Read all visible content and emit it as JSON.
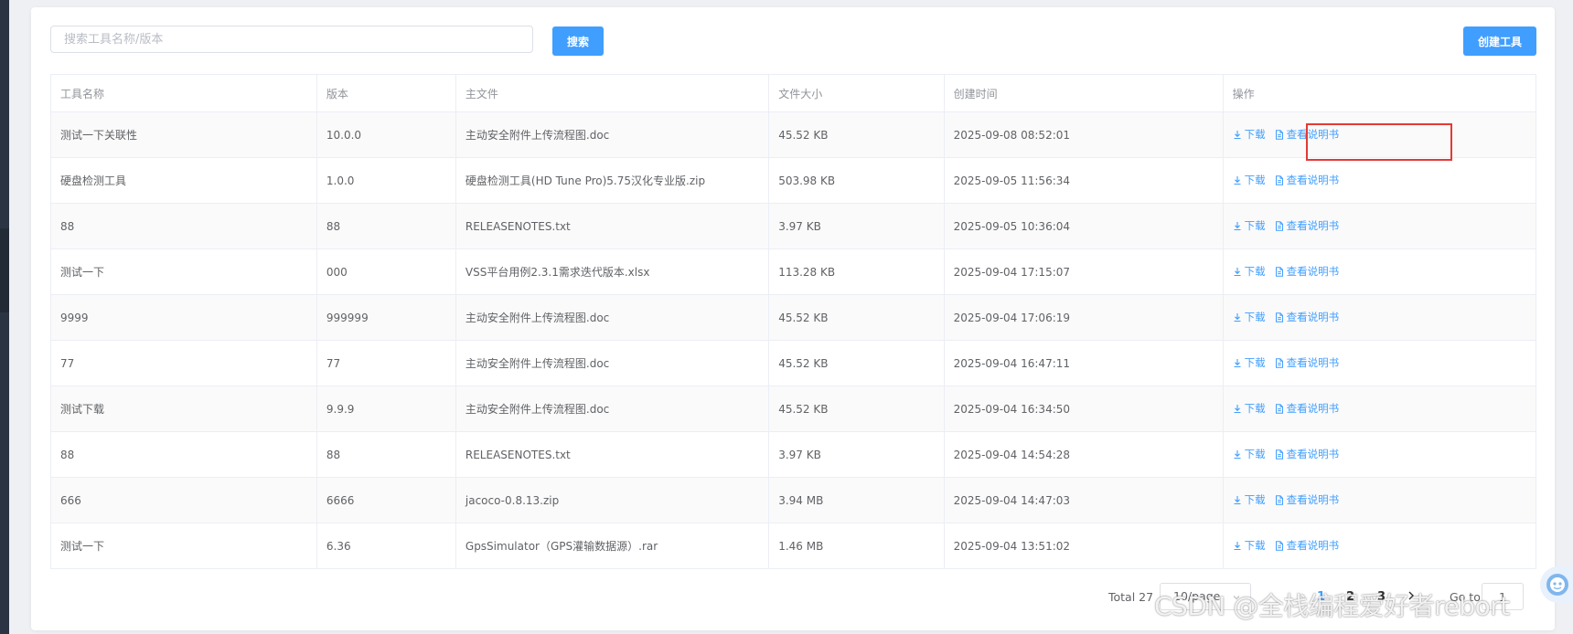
{
  "search": {
    "placeholder": "搜索工具名称/版本",
    "button_label": "搜索"
  },
  "toolbar": {
    "create_label": "创建工具"
  },
  "table": {
    "columns": [
      "工具名称",
      "版本",
      "主文件",
      "文件大小",
      "创建时间",
      "操作"
    ],
    "rows": [
      {
        "name": "测试一下关联性",
        "version": "10.0.0",
        "file": "主动安全附件上传流程图.doc",
        "size": "45.52 KB",
        "created": "2025-09-08 08:52:01"
      },
      {
        "name": "硬盘检测工具",
        "version": "1.0.0",
        "file": "硬盘检测工具(HD Tune Pro)5.75汉化专业版.zip",
        "size": "503.98 KB",
        "created": "2025-09-05 11:56:34"
      },
      {
        "name": "88",
        "version": "88",
        "file": "RELEASENOTES.txt",
        "size": "3.97 KB",
        "created": "2025-09-05 10:36:04"
      },
      {
        "name": "测试一下",
        "version": "000",
        "file": "VSS平台用例2.3.1需求迭代版本.xlsx",
        "size": "113.28 KB",
        "created": "2025-09-04 17:15:07"
      },
      {
        "name": "9999",
        "version": "999999",
        "file": "主动安全附件上传流程图.doc",
        "size": "45.52 KB",
        "created": "2025-09-04 17:06:19"
      },
      {
        "name": "77",
        "version": "77",
        "file": "主动安全附件上传流程图.doc",
        "size": "45.52 KB",
        "created": "2025-09-04 16:47:11"
      },
      {
        "name": "测试下载",
        "version": "9.9.9",
        "file": "主动安全附件上传流程图.doc",
        "size": "45.52 KB",
        "created": "2025-09-04 16:34:50"
      },
      {
        "name": "88",
        "version": "88",
        "file": "RELEASENOTES.txt",
        "size": "3.97 KB",
        "created": "2025-09-04 14:54:28"
      },
      {
        "name": "666",
        "version": "6666",
        "file": "jacoco-0.8.13.zip",
        "size": "3.94 MB",
        "created": "2025-09-04 14:47:03"
      },
      {
        "name": "测试一下",
        "version": "6.36",
        "file": "GpsSimulator（GPS灌输数据源）.rar",
        "size": "1.46 MB",
        "created": "2025-09-04 13:51:02"
      }
    ],
    "actions": {
      "download": "下载",
      "manual": "查看说明书"
    }
  },
  "pagination": {
    "total": "Total 27",
    "page_size": "10/page",
    "pages": [
      "1",
      "2",
      "3"
    ],
    "current": "1",
    "goto_label": "Go to",
    "goto_value": "1"
  },
  "watermark": "CSDN @全栈编程爱好者rebort",
  "colors": {
    "accent": "#409eff",
    "highlight": "#e53935"
  }
}
